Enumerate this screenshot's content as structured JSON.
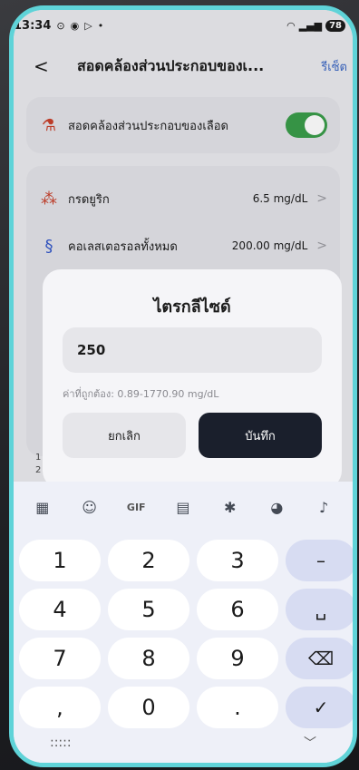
{
  "status_bar": {
    "time": "13:34",
    "icons_left": [
      "screenshot-icon",
      "app-icon",
      "play-icon"
    ],
    "dot": "•",
    "battery": "78"
  },
  "header": {
    "back_icon": "<",
    "title": "สอดคล้องส่วนประกอบของเ...",
    "reset_label": "รีเซ็ต"
  },
  "card_main": {
    "label": "สอดคล้องส่วนประกอบของเลือด",
    "toggle_on": true,
    "accent": "#3a9d4a"
  },
  "items": [
    {
      "icon": "molecule-icon",
      "label": "กรดยูริก",
      "value": "6.5 mg/dL",
      "chevron": ">"
    },
    {
      "icon": "dna-icon",
      "label": "คอเลสเตอรอลทั้งหมด",
      "value": "200.00 mg/dL",
      "chevron": ">"
    }
  ],
  "partial_left": [
    "1",
    "2"
  ],
  "dialog": {
    "title": "ไตรกลีไซด์",
    "input_value": "250",
    "hint": "ค่าที่ถูกต้อง: 0.89-1770.90 mg/dL",
    "cancel_label": "ยกเลิก",
    "save_label": "บันทึก"
  },
  "keyboard": {
    "toolbar": [
      "apps-icon",
      "sticker-icon",
      "GIF",
      "clipboard-icon",
      "settings-icon",
      "palette-icon",
      "mic-icon"
    ],
    "gif_label": "GIF",
    "rows": [
      [
        "1",
        "2",
        "3",
        "–"
      ],
      [
        "4",
        "5",
        "6",
        "␣"
      ],
      [
        "7",
        "8",
        "9",
        "⌫"
      ],
      [
        ",",
        "0",
        ".",
        "✓"
      ]
    ],
    "bottom_left": ":::::",
    "bottom_right": "﹀"
  }
}
